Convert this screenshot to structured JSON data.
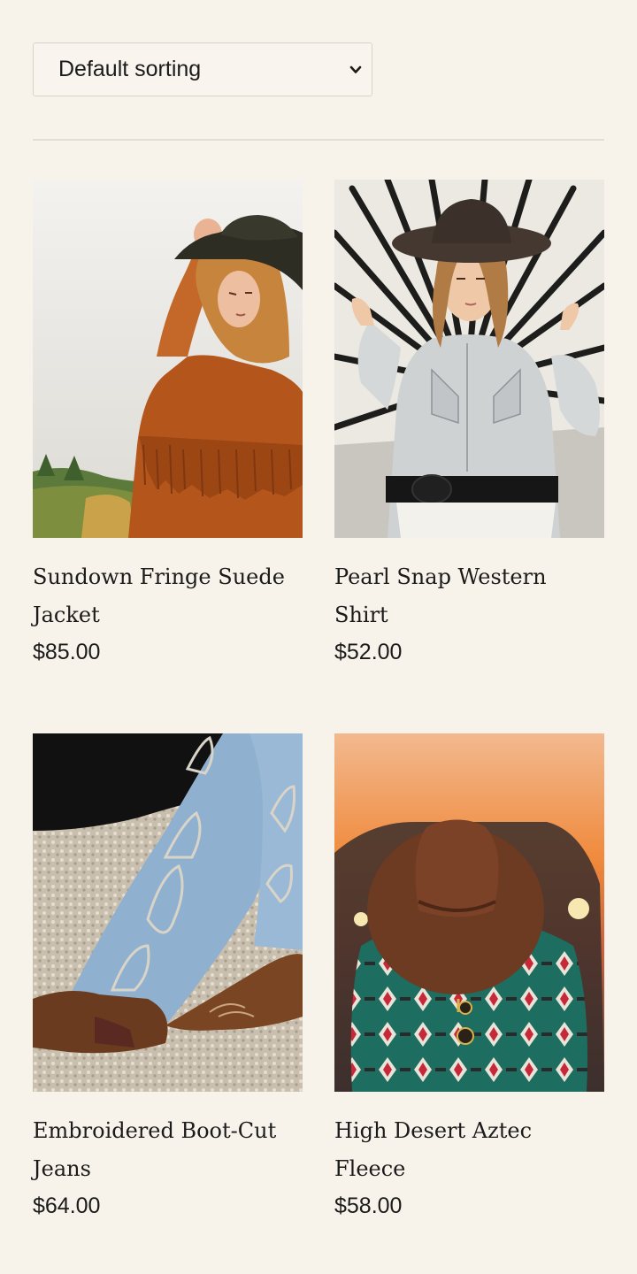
{
  "sort": {
    "selected": "Default sorting",
    "icon": "chevron-down-icon"
  },
  "products": [
    {
      "name": "Sundown Fringe Suede Jacket",
      "price": "$85.00"
    },
    {
      "name": "Pearl Snap Western Shirt",
      "price": "$52.00"
    },
    {
      "name": "Embroidered Boot-Cut Jeans",
      "price": "$64.00"
    },
    {
      "name": "High Desert Aztec Fleece",
      "price": "$58.00"
    }
  ]
}
